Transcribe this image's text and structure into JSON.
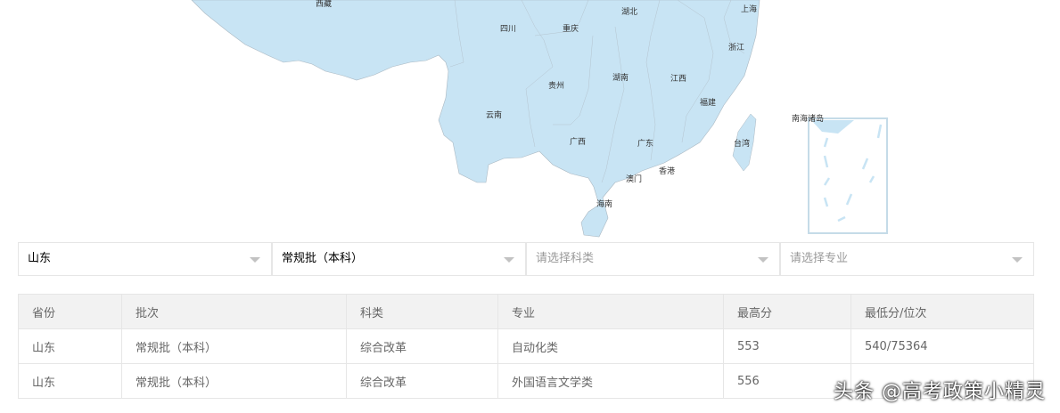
{
  "map": {
    "fill": "#c8e4f4",
    "labels": [
      "西藏",
      "四川",
      "重庆",
      "湖北",
      "上海",
      "浙江",
      "湖南",
      "江西",
      "贵州",
      "福建",
      "云南",
      "广西",
      "广东",
      "台湾",
      "南海诸岛",
      "香港",
      "澳门",
      "海南"
    ]
  },
  "filters": {
    "province": "山东",
    "batch": "常规批（本科）",
    "subject_placeholder": "请选择科类",
    "major_placeholder": "请选择专业"
  },
  "table": {
    "headers": [
      "省份",
      "批次",
      "科类",
      "专业",
      "最高分",
      "最低分/位次"
    ],
    "rows": [
      [
        "山东",
        "常规批（本科）",
        "综合改革",
        "自动化类",
        "553",
        "540/75364"
      ],
      [
        "山东",
        "常规批（本科）",
        "综合改革",
        "外国语言文学类",
        "556",
        ""
      ]
    ]
  },
  "watermark": "头条 @高考政策小精灵"
}
